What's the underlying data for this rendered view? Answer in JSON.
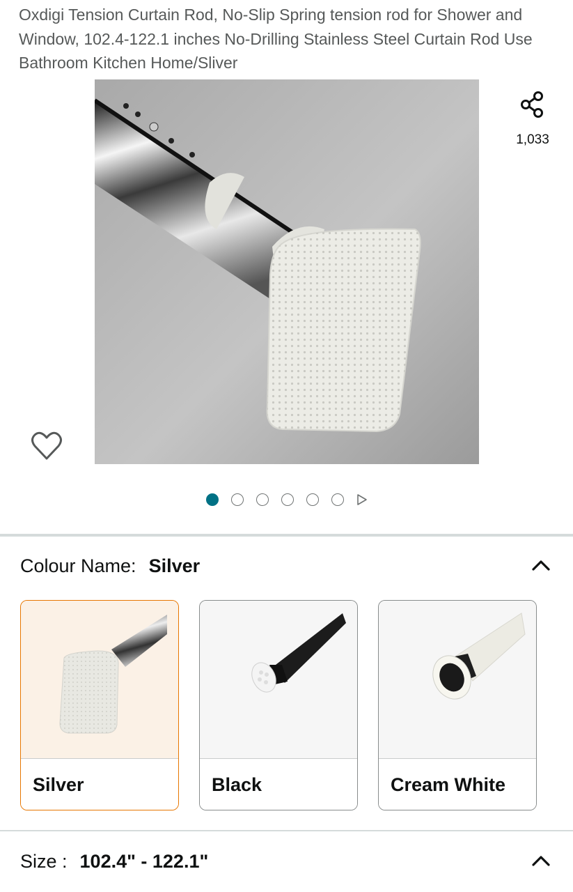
{
  "product": {
    "title": "Oxdigi Tension Curtain Rod, No-Slip Spring tension rod for Shower and Window, 102.4-122.1 inches No-Drilling Stainless Steel Curtain Rod Use Bathroom Kitchen Home/Sliver"
  },
  "gallery": {
    "share_count": "1,033",
    "image_count": 6,
    "active_index": 0
  },
  "colour": {
    "label": "Colour Name:",
    "selected_value": "Silver",
    "options": [
      {
        "name": "Silver",
        "selected": true
      },
      {
        "name": "Black",
        "selected": false
      },
      {
        "name": "Cream White",
        "selected": false
      }
    ]
  },
  "size": {
    "label": "Size :",
    "selected_value": "102.4\" - 122.1\""
  },
  "colors": {
    "accent_teal": "#007185",
    "selected_border": "#e77600",
    "divider": "#d5dbdb"
  },
  "icons": {
    "share": "share-icon",
    "wishlist": "heart-outline-icon",
    "next": "play-triangle-icon",
    "collapse": "chevron-up-icon"
  }
}
